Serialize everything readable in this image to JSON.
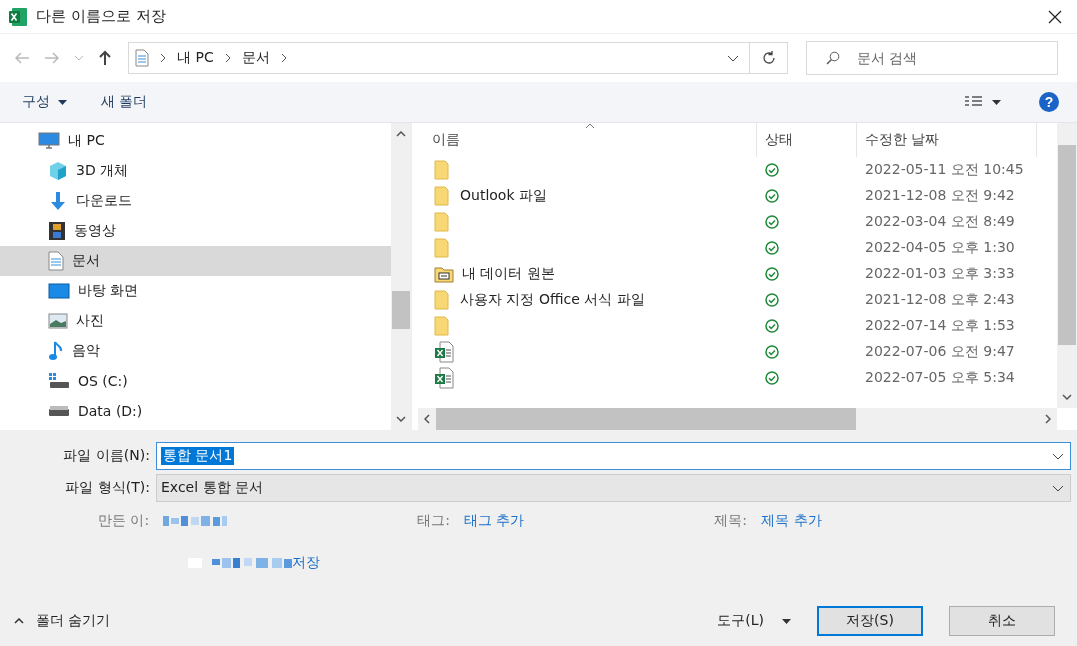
{
  "window": {
    "title": "다른 이름으로 저장"
  },
  "address": {
    "crumbs": [
      "내 PC",
      "문서"
    ]
  },
  "search": {
    "placeholder": "문서 검색"
  },
  "toolbar": {
    "organize": "구성",
    "new_folder": "새 폴더",
    "help": "?"
  },
  "sidebar": {
    "items": [
      {
        "label": "내 PC",
        "kind": "pc",
        "selected": false,
        "children": [
          {
            "label": "3D 개체",
            "kind": "cube",
            "selected": false
          },
          {
            "label": "다운로드",
            "kind": "download",
            "selected": false
          },
          {
            "label": "동영상",
            "kind": "video",
            "selected": false
          },
          {
            "label": "문서",
            "kind": "document",
            "selected": true
          },
          {
            "label": "바탕 화면",
            "kind": "desktop",
            "selected": false
          },
          {
            "label": "사진",
            "kind": "photo",
            "selected": false
          },
          {
            "label": "음악",
            "kind": "music",
            "selected": false
          },
          {
            "label": "OS (C:)",
            "kind": "os-drive",
            "selected": false
          },
          {
            "label": "Data (D:)",
            "kind": "drive",
            "selected": false
          }
        ]
      }
    ]
  },
  "table": {
    "columns": [
      "이름",
      "상태",
      "수정한 날짜"
    ],
    "rows": [
      {
        "kind": "folder",
        "date": "2022-05-11 오전 10:45"
      },
      {
        "kind": "folder",
        "name": "Outlook 파일",
        "date": "2021-12-08 오전 9:42"
      },
      {
        "kind": "folder",
        "date": "2022-03-04 오전 8:49"
      },
      {
        "kind": "folder",
        "date": "2022-04-05 오후 1:30"
      },
      {
        "kind": "linked-folder",
        "name": "내 데이터 원본",
        "date": "2022-01-03 오후 3:33"
      },
      {
        "kind": "folder",
        "name": "사용자 지정 Office 서식 파일",
        "date": "2021-12-08 오후 2:43"
      },
      {
        "kind": "folder",
        "date": "2022-07-14 오후 1:53"
      },
      {
        "kind": "excel",
        "date": "2022-07-06 오전 9:47"
      },
      {
        "kind": "excel",
        "date": "2022-07-05 오후 5:34"
      }
    ]
  },
  "form": {
    "file_name_label": "파일 이름(N):",
    "file_name": "통합 문서1",
    "file_type_label": "파일 형식(T):",
    "file_type": "Excel 통합 문서",
    "author_label": "만든 이:",
    "tags_label": "태그:",
    "tags_link": "태그 추가",
    "title_label": "제목:",
    "title_link": "제목 추가",
    "save_thumb_link": "저장"
  },
  "footer": {
    "hide_folders": "폴더 숨기기",
    "tools": "도구(L)",
    "save": "저장(S)",
    "cancel": "취소"
  }
}
